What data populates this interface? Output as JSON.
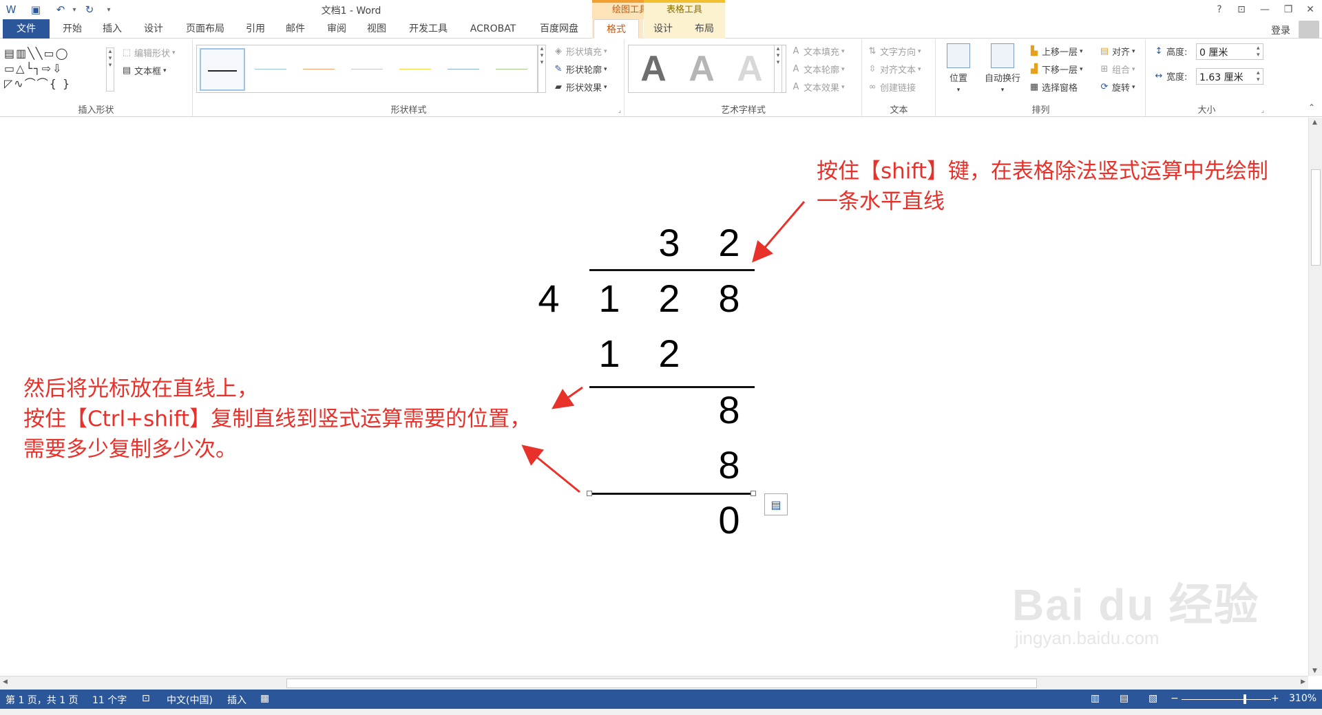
{
  "window": {
    "title": "文档1 - Word",
    "context_tabs": {
      "drawing_tools": "绘图工具",
      "table_tools": "表格工具"
    },
    "controls": {
      "help": "?",
      "ribbon_display": "⊡",
      "minimize": "—",
      "restore": "❐",
      "close": "✕"
    },
    "login": "登录"
  },
  "quick_access": {
    "word_icon": "W",
    "save_icon": "💾",
    "undo_icon": "↶",
    "redo_icon": "↻",
    "customize_icon": "⋯"
  },
  "tabs": {
    "file": "文件",
    "home": "开始",
    "insert": "插入",
    "design": "设计",
    "layout": "页面布局",
    "references": "引用",
    "mailings": "邮件",
    "review": "审阅",
    "view": "视图",
    "developer": "开发工具",
    "acrobat": "ACROBAT",
    "baidu": "百度网盘",
    "format": "格式",
    "table_design": "设计",
    "table_layout": "布局"
  },
  "ribbon": {
    "insert_shapes": {
      "label": "插入形状",
      "edit_shape": "编辑形状",
      "text_box": "文本框"
    },
    "shape_styles": {
      "label": "形状样式",
      "fill": "形状填充",
      "outline": "形状轮廓",
      "effects": "形状效果"
    },
    "wordart_styles": {
      "label": "艺术字样式",
      "letter": "A",
      "text_fill": "文本填充",
      "text_outline": "文本轮廓",
      "text_effects": "文本效果"
    },
    "text": {
      "label": "文本",
      "direction": "文字方向",
      "align_text": "对齐文本",
      "create_link": "创建链接"
    },
    "arrange": {
      "label": "排列",
      "position": "位置",
      "wrap_text": "自动换行",
      "bring_forward": "上移一层",
      "send_backward": "下移一层",
      "selection_pane": "选择窗格",
      "align": "对齐",
      "group": "组合",
      "rotate": "旋转"
    },
    "size": {
      "label": "大小",
      "height_label": "高度:",
      "height_value": "0 厘米",
      "width_label": "宽度:",
      "width_value": "1.63 厘米"
    }
  },
  "document": {
    "quotient": [
      "3",
      "2"
    ],
    "divisor": "4",
    "dividend": [
      "1",
      "2",
      "8"
    ],
    "step1": [
      "1",
      "2"
    ],
    "remainder1": "8",
    "step2": "8",
    "result": "0",
    "note_top": [
      "按住【shift】键，在表格除法竖式运算中先绘制",
      "一条水平直线"
    ],
    "note_left": [
      "然后将光标放在直线上，",
      "按住【Ctrl+shift】复制直线到竖式运算需要的位置，",
      "需要多少复制多少次。"
    ],
    "annotation_color": "#e8312a"
  },
  "watermark": {
    "logo": "Bai du 经验",
    "url": "jingyan.baidu.com"
  },
  "status": {
    "page": "第 1 页，共 1 页",
    "words": "11 个字",
    "language": "中文(中国)",
    "mode": "插入",
    "zoom": "310%"
  }
}
